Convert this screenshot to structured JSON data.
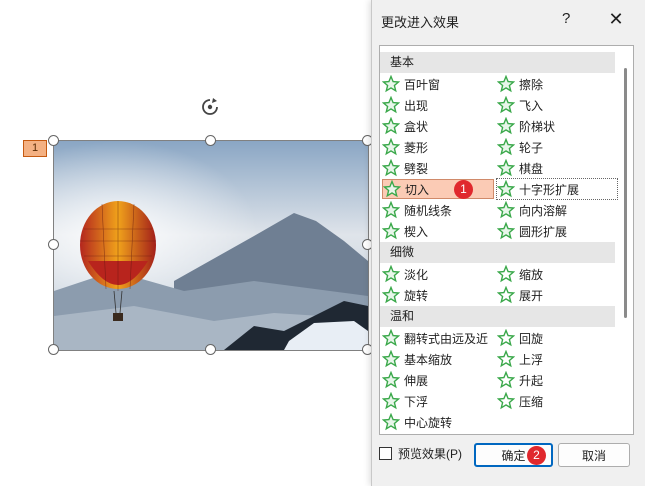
{
  "slide": {
    "animation_number": "1"
  },
  "dialog": {
    "title": "更改进入效果",
    "help_label": "?",
    "close_label": "✕",
    "groups": [
      {
        "label": "基本",
        "items": [
          [
            "百叶窗",
            "擦除"
          ],
          [
            "出现",
            "飞入"
          ],
          [
            "盒状",
            "阶梯状"
          ],
          [
            "菱形",
            "轮子"
          ],
          [
            "劈裂",
            "棋盘"
          ],
          [
            "切入",
            "十字形扩展"
          ],
          [
            "随机线条",
            "向内溶解"
          ],
          [
            "楔入",
            "圆形扩展"
          ]
        ]
      },
      {
        "label": "细微",
        "items": [
          [
            "淡化",
            "缩放"
          ],
          [
            "旋转",
            "展开"
          ]
        ]
      },
      {
        "label": "温和",
        "items": [
          [
            "翻转式由远及近",
            "回旋"
          ],
          [
            "基本缩放",
            "上浮"
          ],
          [
            "伸展",
            "升起"
          ],
          [
            "下浮",
            "压缩"
          ],
          [
            "中心旋转",
            ""
          ]
        ]
      }
    ],
    "selected_effect": "切入",
    "badge_1": "1",
    "badge_2": "2",
    "preview_label": "预览效果(P)",
    "ok_label": "确定",
    "cancel_label": "取消"
  },
  "colors": {
    "star_green": "#3aa84a",
    "selection": "#fbcbb5",
    "badge_red": "#e0282d",
    "ok_border": "#0067c0"
  }
}
